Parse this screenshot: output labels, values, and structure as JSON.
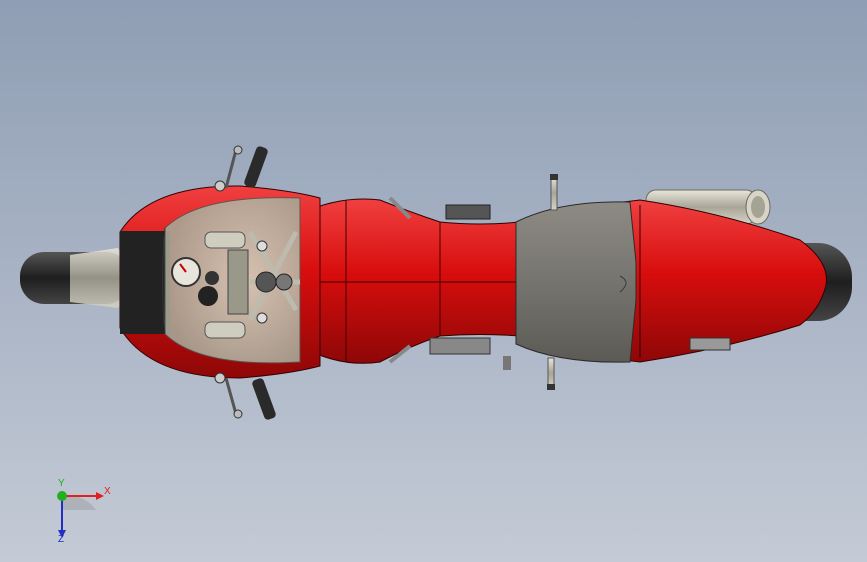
{
  "viewport": {
    "background_top": "#8f9eb4",
    "background_bottom": "#c4cbd6"
  },
  "model": {
    "body_color": "#e01010",
    "seat_color": "#7d7b74",
    "tire_color": "#2b2b2b",
    "exhaust_color": "#c9c6b8"
  },
  "triad": {
    "x_label": "X",
    "y_label": "Y",
    "z_label": "Z",
    "x_color": "#e02020",
    "y_color": "#20b020",
    "z_color": "#2030c0"
  }
}
